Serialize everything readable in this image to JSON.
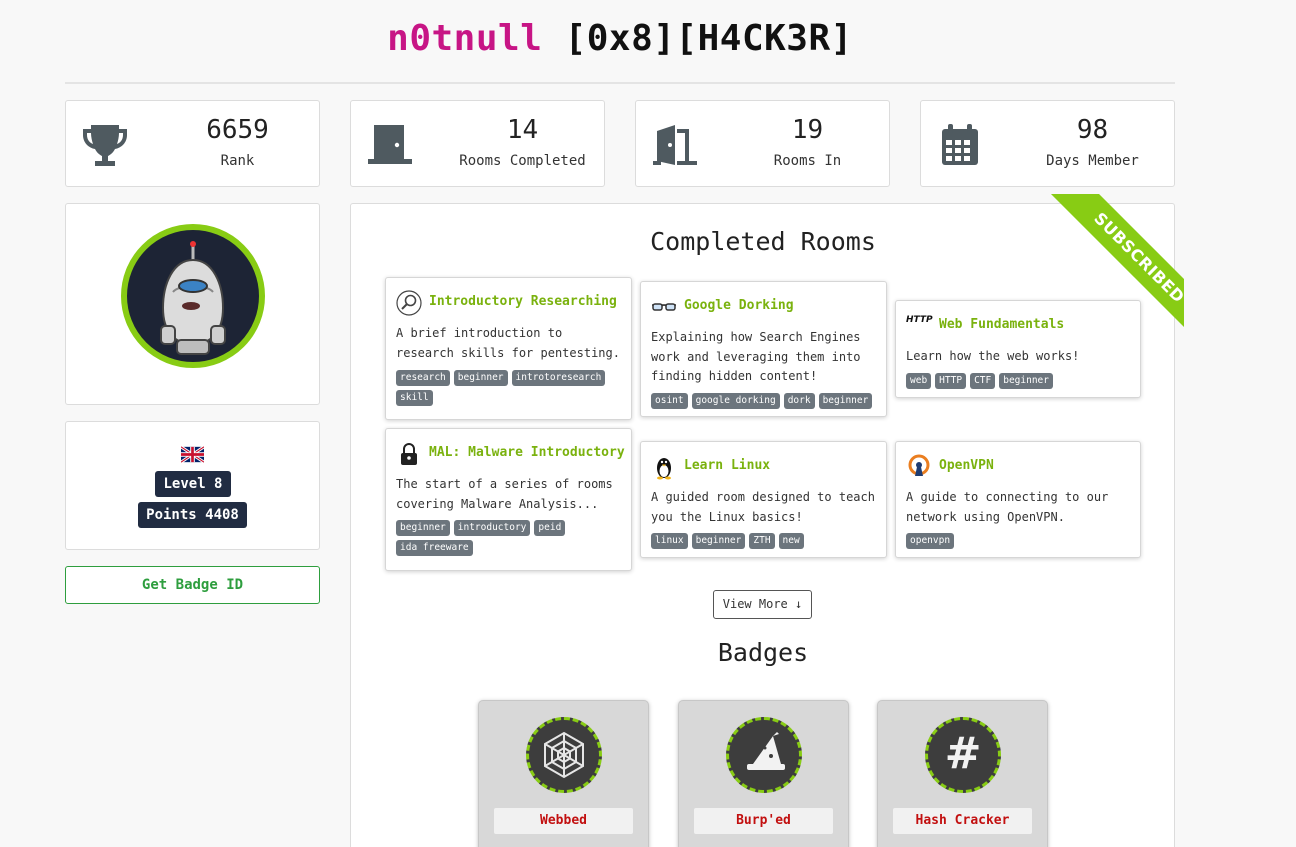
{
  "header": {
    "username": "n0tnull",
    "rank_title": "[0x8][H4CK3R]"
  },
  "stats": [
    {
      "icon": "trophy-icon",
      "value": "6659",
      "label": "Rank"
    },
    {
      "icon": "door-closed-icon",
      "value": "14",
      "label": "Rooms Completed"
    },
    {
      "icon": "door-open-icon",
      "value": "19",
      "label": "Rooms In"
    },
    {
      "icon": "calendar-icon",
      "value": "98",
      "label": "Days Member"
    }
  ],
  "profile": {
    "country_flag": "uk-flag",
    "level": "Level 8",
    "points": "Points 4408",
    "badge_button": "Get Badge ID"
  },
  "completed_rooms": {
    "heading": "Completed Rooms",
    "ribbon": "SUBSCRIBED",
    "rooms": [
      {
        "title": "Introductory Researching",
        "icon": "magnifier-icon",
        "description": "A brief introduction to research skills for pentesting.",
        "tags": [
          "research",
          "beginner",
          "introtoresearch",
          "skill"
        ]
      },
      {
        "title": "Google Dorking",
        "icon": "glasses-icon",
        "description": "Explaining how Search Engines work and leveraging them into finding hidden content!",
        "tags": [
          "osint",
          "google dorking",
          "dork",
          "beginner"
        ]
      },
      {
        "title": "Web Fundamentals",
        "icon": "http-icon",
        "icon_text": "HTTP",
        "description": "Learn how the web works!",
        "tags": [
          "web",
          "HTTP",
          "CTF",
          "beginner"
        ]
      },
      {
        "title": "MAL: Malware Introductory",
        "icon": "padlock-icon",
        "description": "The start of a series of rooms covering Malware Analysis...",
        "tags": [
          "beginner",
          "introductory",
          "peid",
          "ida freeware"
        ]
      },
      {
        "title": "Learn Linux",
        "icon": "tux-penguin-icon",
        "description": "A guided room designed to teach you the Linux basics!",
        "tags": [
          "linux",
          "beginner",
          "ZTH",
          "new"
        ]
      },
      {
        "title": "OpenVPN",
        "icon": "openvpn-icon",
        "description": "A guide to connecting to our network using OpenVPN.",
        "tags": [
          "openvpn"
        ]
      }
    ],
    "view_more": "View More ↓"
  },
  "badges": {
    "heading": "Badges",
    "items": [
      {
        "name": "Webbed",
        "icon": "spiderweb-icon"
      },
      {
        "name": "Burp'ed",
        "icon": "wizard-hat-icon"
      },
      {
        "name": "Hash Cracker",
        "icon": "hash-icon",
        "glyph": "#"
      }
    ]
  },
  "colors": {
    "accent_green": "#88cc14",
    "username_pink": "#c71585",
    "level_navy": "#212c42",
    "badge_name_red": "#c21010"
  }
}
